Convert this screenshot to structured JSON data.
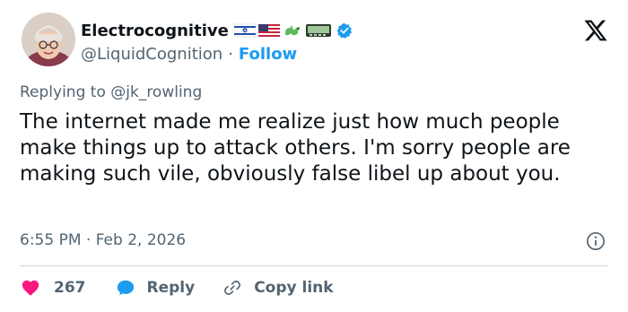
{
  "author": {
    "display_name": "Electrocognitive",
    "handle": "@LiquidCognition",
    "separator": "·",
    "follow_label": "Follow"
  },
  "reply_context": {
    "prefix": "Replying to ",
    "mention": "@jk_rowling"
  },
  "tweet": {
    "text": "The internet made me realize just how much people make things up to attack others. I'm sorry people are making such vile, obviously false libel up about you.",
    "timestamp": "6:55 PM · Feb 2, 2026"
  },
  "actions": {
    "like_count": "267",
    "reply_label": "Reply",
    "copy_label": "Copy link"
  },
  "colors": {
    "accent": "#1d9bf0",
    "like": "#f91880",
    "muted": "#536471",
    "text": "#0f1419"
  },
  "icons": [
    "x-logo-icon",
    "verified-badge-icon",
    "israel-flag-icon",
    "us-flag-icon",
    "dragon-icon",
    "keyboard-icon",
    "info-icon",
    "heart-icon",
    "reply-bubble-icon",
    "link-icon"
  ]
}
